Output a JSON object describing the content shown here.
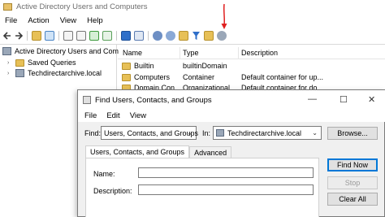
{
  "main_window": {
    "title": "Active Directory Users and Computers",
    "menu": [
      "File",
      "Action",
      "View",
      "Help"
    ],
    "tree": {
      "root": "Active Directory Users and Com",
      "items": [
        {
          "label": "Saved Queries",
          "icon": "folder-icon"
        },
        {
          "label": "Techdirectarchive.local",
          "icon": "domain-icon"
        }
      ]
    },
    "list": {
      "columns": [
        "Name",
        "Type",
        "Description"
      ],
      "rows": [
        {
          "name": "Builtin",
          "type": "builtinDomain",
          "description": ""
        },
        {
          "name": "Computers",
          "type": "Container",
          "description": "Default container for up..."
        },
        {
          "name": "Domain Con...",
          "type": "Organizational...",
          "description": "Default container for do..."
        }
      ]
    },
    "colors": {
      "annotation_arrow": "#e02020"
    }
  },
  "dialog": {
    "title": "Find Users, Contacts, and Groups",
    "menu": [
      "File",
      "Edit",
      "View"
    ],
    "find_label": "Find:",
    "find_value": "Users, Contacts, and Groups",
    "in_label": "In:",
    "in_value": "Techdirectarchive.local",
    "browse_label": "Browse...",
    "tabs": [
      "Users, Contacts, and Groups",
      "Advanced"
    ],
    "fields": {
      "name_label": "Name:",
      "description_label": "Description:"
    },
    "buttons": {
      "find_now": "Find Now",
      "stop": "Stop",
      "clear_all": "Clear All"
    },
    "window_controls": {
      "minimize": "—",
      "maximize": "☐",
      "close": "✕"
    }
  }
}
